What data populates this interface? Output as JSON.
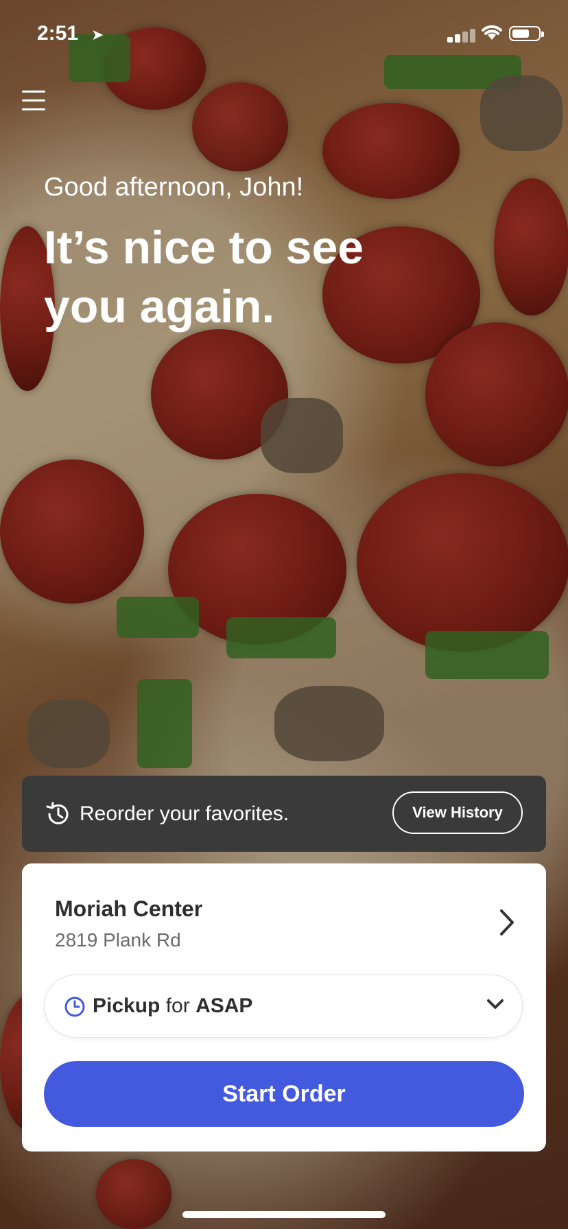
{
  "status_bar": {
    "time": "2:51",
    "location_icon": "location-arrow-icon"
  },
  "menu": {
    "icon": "hamburger-menu-icon"
  },
  "hero": {
    "greeting": "Good afternoon, John!",
    "headline": "It’s nice to see you again."
  },
  "reorder": {
    "icon": "history-icon",
    "label": "Reorder your favorites.",
    "button_label": "View History"
  },
  "store": {
    "name": "Moriah Center",
    "address": "2819 Plank Rd"
  },
  "pickup": {
    "mode": "Pickup",
    "connector": "for",
    "time": "ASAP",
    "accent": "#4359de"
  },
  "start_order": {
    "label": "Start Order",
    "color": "#4359de"
  }
}
